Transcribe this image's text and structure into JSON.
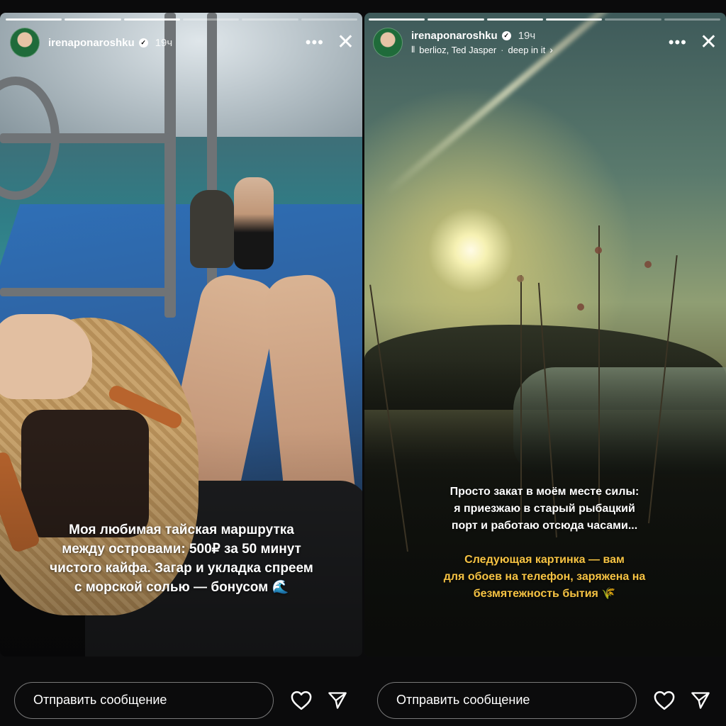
{
  "stories": [
    {
      "username": "irenaponaroshku",
      "verified_mark": "✓",
      "time": "19ч",
      "music": null,
      "caption": [
        "Моя любимая тайская маршрутка",
        "между островами: 500₽ за 50 минут",
        "чистого кайфа. Загар и укладка спреем",
        "с морской солью — бонусом 🌊"
      ],
      "message_placeholder": "Отправить сообщение",
      "progress": {
        "total": 6,
        "done": 3
      }
    },
    {
      "username": "irenaponaroshku",
      "verified_mark": "✓",
      "time": "19ч",
      "music": {
        "icon": "music-bars-icon",
        "artists": "berlioz, Ted Jasper",
        "track": "deep in it"
      },
      "caption_white": [
        "Просто закат в моём месте силы:",
        "я приезжаю в старый рыбацкий",
        "порт и работаю отсюда часами..."
      ],
      "caption_yellow": [
        "Следующая картинка — вам",
        "для обоев на телефон, заряжена на",
        "безмятежность бытия 🌾"
      ],
      "message_placeholder": "Отправить сообщение",
      "progress": {
        "total": 6,
        "done": 4
      }
    }
  ],
  "icons": {
    "more": "•••",
    "close": "✕",
    "music": "⦀",
    "chevron": "›",
    "heart": "heart-icon",
    "send": "send-icon"
  },
  "colors": {
    "accent_caption": "#f6c343",
    "background": "#0b0b0c"
  }
}
